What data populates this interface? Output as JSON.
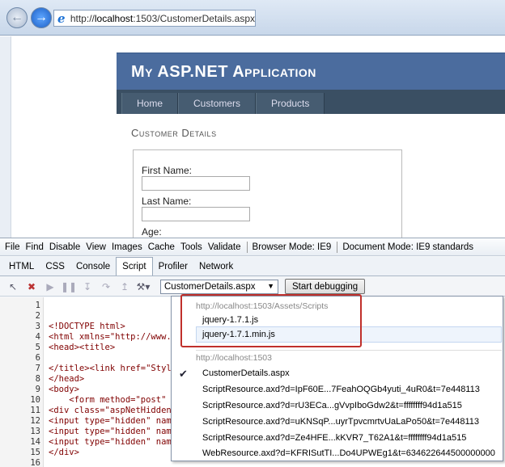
{
  "browser": {
    "url_prefix": "http://",
    "url_host": "localhost",
    "url_rest": ":1503/CustomerDetails.aspx"
  },
  "site": {
    "title": "My ASP.NET Application",
    "menu": [
      "Home",
      "Customers",
      "Products"
    ],
    "section_title": "Customer Details",
    "fields": [
      {
        "label": "First Name:"
      },
      {
        "label": "Last Name:"
      },
      {
        "label": "Age:"
      }
    ]
  },
  "devtools": {
    "menubar": [
      "File",
      "Find",
      "Disable",
      "View",
      "Images",
      "Cache",
      "Tools",
      "Validate"
    ],
    "browser_mode": "Browser Mode: IE9",
    "document_mode": "Document Mode: IE9 standards",
    "tabs": [
      "HTML",
      "CSS",
      "Console",
      "Script",
      "Profiler",
      "Network"
    ],
    "active_tab": "Script",
    "selected_file": "CustomerDetails.aspx",
    "start_debugging": "Start debugging",
    "toolbar_icons": [
      "select-element-icon",
      "clear-browser-icon",
      "run-icon",
      "pause-icon",
      "step-into-icon",
      "step-over-icon",
      "step-out-icon",
      "break-on-error-icon"
    ]
  },
  "code": {
    "line_numbers": [
      "1",
      "2",
      "3",
      "4",
      "5",
      "6",
      "7",
      "8",
      "9",
      "10",
      "11",
      "12",
      "13",
      "14",
      "15",
      "16"
    ],
    "lines": [
      "",
      "",
      "<!DOCTYPE html>",
      "<html xmlns=\"http://www.w",
      "<head><title>",
      "",
      "</title><link href=\"Style",
      "</head>",
      "<body>",
      "    <form method=\"post\" a",
      "<div class=\"aspNetHidden\"",
      "<input type=\"hidden\" name",
      "<input type=\"hidden\" name",
      "<input type=\"hidden\" name",
      "</div>",
      ""
    ]
  },
  "dropdown": {
    "group1": "http://localhost:1503/Assets/Scripts",
    "group1_items": [
      "jquery-1.7.1.js",
      "jquery-1.7.1.min.js"
    ],
    "group2": "http://localhost:1503",
    "group2_items": [
      "CustomerDetails.aspx",
      "ScriptResource.axd?d=IpF60E...7FeahOQGb4yuti_4uR0&t=7e448113",
      "ScriptResource.axd?d=rU3ECa...gVvpIboGdw2&t=ffffffff94d1a515",
      "ScriptResource.axd?d=uKNSqP...uyrTpvcmrtvUaLaPo50&t=7e448113",
      "ScriptResource.axd?d=Ze4HFE...kKVR7_T62A1&t=ffffffff94d1a515",
      "WebResource.axd?d=KFRISutTI...Do4UPWEg1&t=634622644500000000"
    ],
    "checked_item": "CustomerDetails.aspx"
  },
  "colors": {
    "site_header": "#4b6c9e",
    "site_menu": "#3a4f63",
    "highlight": "#c0302b"
  }
}
